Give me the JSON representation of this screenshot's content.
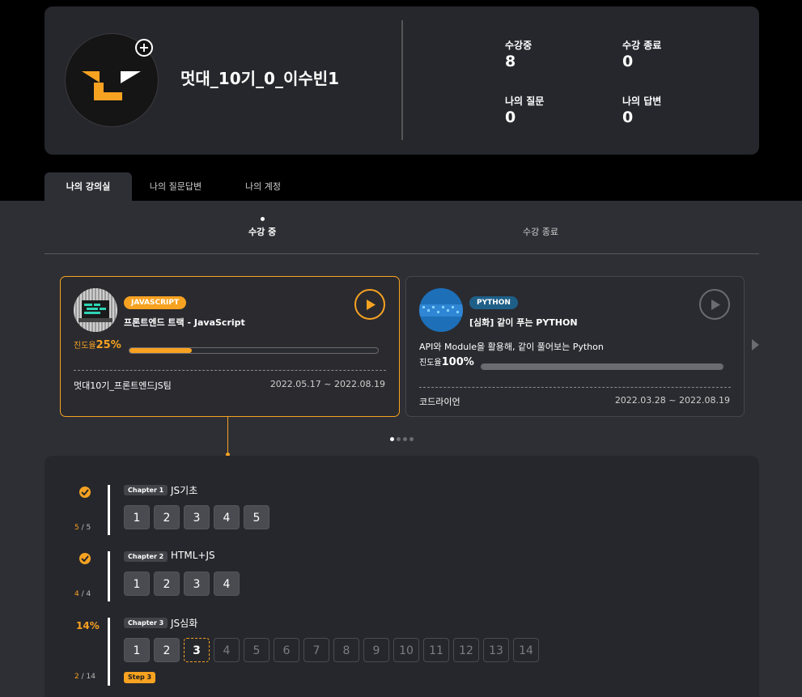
{
  "profile": {
    "username": "멋대_10기_0_이수빈1",
    "stats": [
      {
        "label": "수강중",
        "value": "8"
      },
      {
        "label": "수강 종료",
        "value": "0"
      },
      {
        "label": "나의 질문",
        "value": "0"
      },
      {
        "label": "나의 답변",
        "value": "0"
      }
    ]
  },
  "tabs": [
    "나의 강의실",
    "나의 질문답변",
    "나의 계정"
  ],
  "subtabs": [
    "수강 중",
    "수강 종료"
  ],
  "courses": [
    {
      "badge": "JAVASCRIPT",
      "title": "프론트엔드 트랙 - JavaScript",
      "progress_label": "진도율",
      "progress_value": "25%",
      "progress": 0.25,
      "team": "멋대10기_프론트엔드JS팀",
      "period": "2022.05.17 ~ 2022.08.19"
    },
    {
      "badge": "PYTHON",
      "title": "[심화] 같이 푸는 PYTHON",
      "description": "API와 Module을 활용해, 같이 풀어보는 Python",
      "progress_label": "진도율",
      "progress_value": "100%",
      "progress": 1.0,
      "team": "코드라이언",
      "period": "2022.03.28 ~ 2022.08.19"
    }
  ],
  "chapters": [
    {
      "tag": "Chapter 1",
      "title": "JS기초",
      "done": "5",
      "total": "5",
      "steps": [
        "1",
        "2",
        "3",
        "4",
        "5"
      ],
      "completed": 5
    },
    {
      "tag": "Chapter 2",
      "title": "HTML+JS",
      "done": "4",
      "total": "4",
      "steps": [
        "1",
        "2",
        "3",
        "4"
      ],
      "completed": 4
    },
    {
      "tag": "Chapter 3",
      "title": "JS심화",
      "done": "2",
      "total": "14",
      "percent": "14%",
      "steps": [
        "1",
        "2",
        "3",
        "4",
        "5",
        "6",
        "7",
        "8",
        "9",
        "10",
        "11",
        "12",
        "13",
        "14"
      ],
      "completed": 2,
      "current": 3,
      "current_tag": "Step 3"
    }
  ],
  "count_sep": "/",
  "colors": {
    "accent": "#f7a221",
    "panel": "#26272c",
    "surface": "#2e2f35"
  }
}
